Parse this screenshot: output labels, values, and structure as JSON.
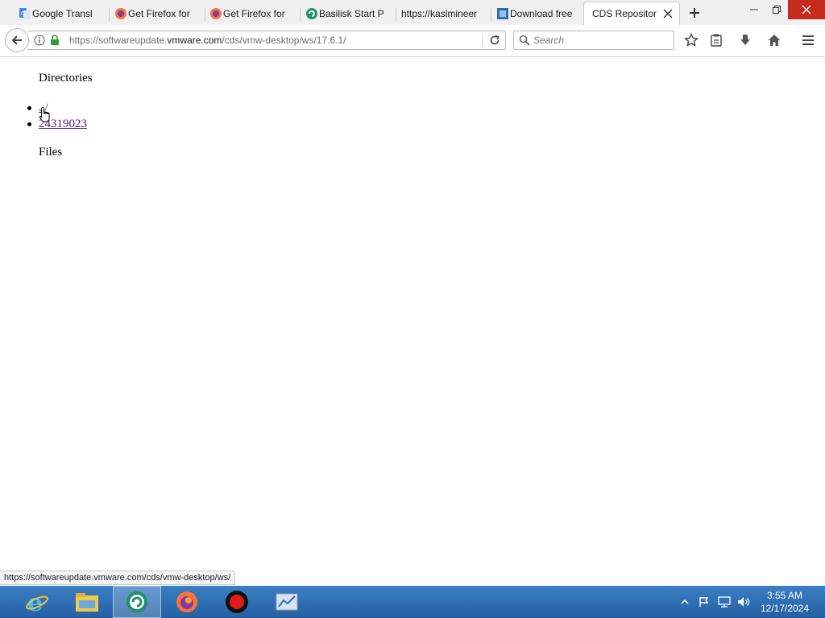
{
  "browser": {
    "tabs": [
      {
        "title": "Google Transl",
        "icon": "google-translate-icon",
        "selected": false
      },
      {
        "title": "Get Firefox for",
        "icon": "firefox-icon",
        "selected": false
      },
      {
        "title": "Get Firefox for",
        "icon": "firefox-icon",
        "selected": false
      },
      {
        "title": "Basilisk Start P",
        "icon": "basilisk-icon",
        "selected": false
      },
      {
        "title": "https://kaslmineer",
        "icon": "",
        "selected": false
      },
      {
        "title": "Download free",
        "icon": "download-site-icon",
        "selected": false
      },
      {
        "title": "CDS Repositor",
        "icon": "",
        "selected": true
      }
    ],
    "url": {
      "prefix": "https://softwareupdate.",
      "domain": "vmware.com",
      "path": "/cds/vmw-desktop/ws/17.6.1/"
    },
    "search": {
      "placeholder": "Search",
      "value": ""
    }
  },
  "page": {
    "directories_heading": "Directories",
    "directories": [
      {
        "label": "../"
      },
      {
        "label": "24319023"
      }
    ],
    "files_heading": "Files"
  },
  "status_bar": {
    "text": "https://softwareupdate.vmware.com/cds/vmw-desktop/ws/"
  },
  "taskbar": {
    "apps": [
      {
        "name": "internet-explorer-icon",
        "active": false
      },
      {
        "name": "file-explorer-icon",
        "active": false
      },
      {
        "name": "basilisk-browser-icon",
        "active": true
      },
      {
        "name": "firefox-icon",
        "active": false
      },
      {
        "name": "record-icon",
        "active": false
      },
      {
        "name": "server-manager-icon",
        "active": false
      }
    ],
    "clock": {
      "time": "3:55 AM",
      "date": "12/17/2024"
    }
  },
  "colors": {
    "taskbar": "#2a6ab0",
    "link_visited": "#551a8b",
    "lock_green": "#2e9e3a",
    "close_red": "#c42b1c"
  }
}
